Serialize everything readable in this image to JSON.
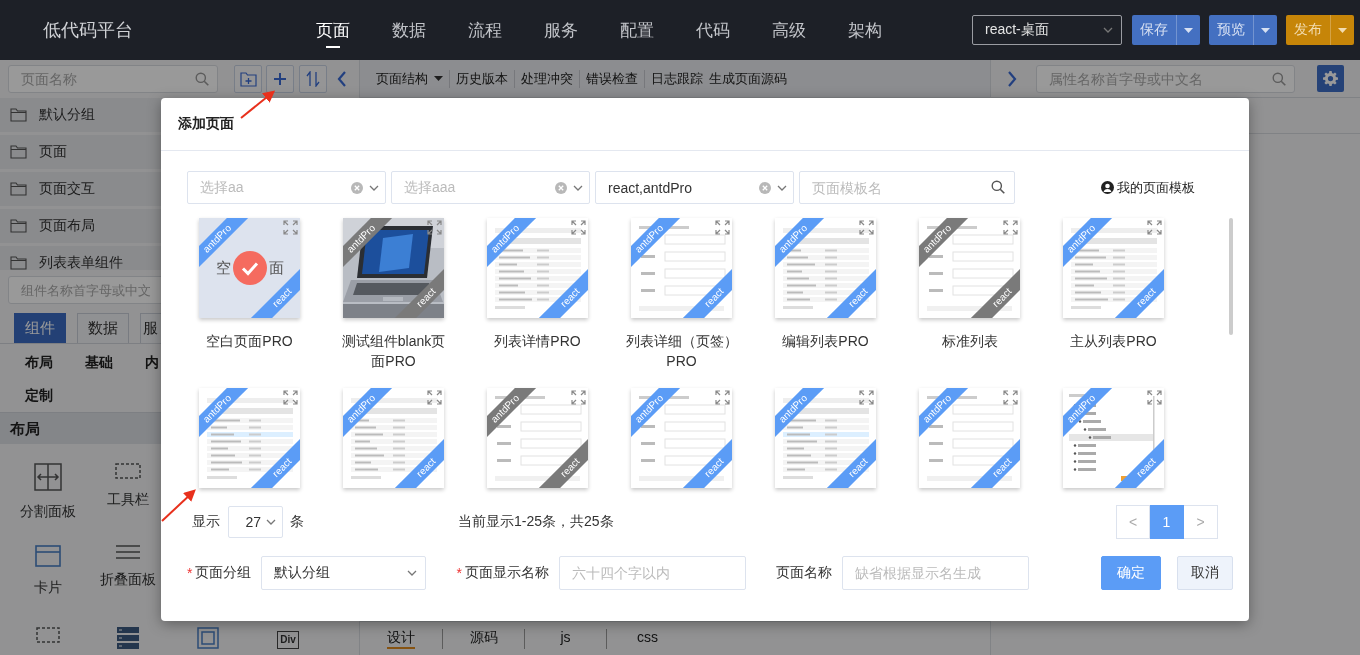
{
  "header": {
    "logo": "低代码平台",
    "nav": [
      {
        "label": "页面",
        "selected": true
      },
      {
        "label": "数据",
        "selected": false
      },
      {
        "label": "流程",
        "selected": false
      },
      {
        "label": "服务",
        "selected": false
      },
      {
        "label": "配置",
        "selected": false
      },
      {
        "label": "代码",
        "selected": false
      },
      {
        "label": "高级",
        "selected": false
      },
      {
        "label": "架构",
        "selected": false
      }
    ],
    "app_select": "react-桌面",
    "actions": [
      {
        "label": "保存",
        "kind": "primary"
      },
      {
        "label": "预览",
        "kind": "primary"
      },
      {
        "label": "发布",
        "kind": "warning"
      }
    ]
  },
  "left_panel": {
    "search_placeholder": "页面名称",
    "groups": [
      "默认分组",
      "页面",
      "页面交互",
      "页面布局",
      "列表表单组件"
    ],
    "component_search_placeholder": "组件名称首字母或中文",
    "tabs": [
      {
        "label": "组件",
        "selected": true
      },
      {
        "label": "数据",
        "selected": false
      },
      {
        "label": "服",
        "selected": false
      }
    ],
    "categories": [
      "布局",
      "基础",
      "内",
      "定制"
    ],
    "section": "布局",
    "component_rows": [
      [
        {
          "kind": "split",
          "label": "分割面板"
        },
        {
          "kind": "toolbar",
          "label": "工具栏"
        }
      ],
      [
        {
          "kind": "card",
          "label": "卡片"
        },
        {
          "kind": "collapse",
          "label": "折叠面板"
        }
      ],
      [
        {
          "kind": "dashed"
        },
        {
          "kind": "list"
        },
        {
          "kind": "frame"
        },
        {
          "kind": "tag",
          "tag": "Div"
        }
      ]
    ]
  },
  "center": {
    "toolbar": [
      {
        "label": "页面结构",
        "kind": "dropdown",
        "separated": false
      },
      {
        "label": "历史版本",
        "kind": "link",
        "separated": true
      },
      {
        "label": "处理冲突",
        "kind": "link",
        "separated": true
      },
      {
        "label": "错误检查",
        "kind": "link",
        "separated": true
      },
      {
        "label": "日志跟踪",
        "kind": "link",
        "separated": true
      },
      {
        "label": "生成页面源码",
        "kind": "link",
        "separated": false
      }
    ],
    "bottom_tabs": [
      {
        "label": "设计",
        "selected": true
      },
      {
        "label": "源码",
        "selected": false
      },
      {
        "label": "js",
        "selected": false
      },
      {
        "label": "css",
        "selected": false
      }
    ]
  },
  "right_panel": {
    "search_placeholder": "属性名称首字母或中文名"
  },
  "modal": {
    "title": "添加页面",
    "filters": [
      {
        "kind": "select",
        "placeholder": "选择aa"
      },
      {
        "kind": "select",
        "placeholder": "选择aaa"
      },
      {
        "kind": "select",
        "value": "react,antdPro"
      },
      {
        "kind": "search",
        "placeholder": "页面模板名"
      }
    ],
    "my_templates": "我的页面模板",
    "templates": [
      {
        "name": "空白页面PRO",
        "selected": true,
        "kind": "blank",
        "blank_text": [
          "空",
          "面"
        ],
        "tags": [
          {
            "text": "antdPro",
            "color": "#5b9cf6"
          },
          {
            "text": "react",
            "color": "#5b9cf6"
          }
        ]
      },
      {
        "name": "测试组件blank页面PRO",
        "selected": false,
        "kind": "picture",
        "tags": [
          {
            "text": "antdPro",
            "color": "#7a7a7a"
          },
          {
            "text": "react",
            "color": "#7a7a7a"
          }
        ]
      },
      {
        "name": "列表详情PRO",
        "selected": false,
        "kind": "table",
        "tags": [
          {
            "text": "antdPro",
            "color": "#5b9cf6"
          },
          {
            "text": "react",
            "color": "#5b9cf6"
          }
        ]
      },
      {
        "name": "列表详细（页签）PRO",
        "selected": false,
        "kind": "form",
        "tags": [
          {
            "text": "antdPro",
            "color": "#5b9cf6"
          },
          {
            "text": "react",
            "color": "#5b9cf6"
          }
        ]
      },
      {
        "name": "编辑列表PRO",
        "selected": false,
        "kind": "table",
        "tags": [
          {
            "text": "antdPro",
            "color": "#5b9cf6"
          },
          {
            "text": "react",
            "color": "#5b9cf6"
          }
        ]
      },
      {
        "name": "标准列表",
        "selected": false,
        "kind": "form",
        "tags": [
          {
            "text": "antdPro",
            "color": "#7a7a7a"
          },
          {
            "text": "react",
            "color": "#7a7a7a"
          }
        ]
      },
      {
        "name": "主从列表PRO",
        "selected": false,
        "kind": "table",
        "tags": [
          {
            "text": "antdPro",
            "color": "#5b9cf6"
          },
          {
            "text": "react",
            "color": "#5b9cf6"
          }
        ]
      },
      {
        "selected": false,
        "kind": "table",
        "tags": [
          {
            "text": "antdPro",
            "color": "#5b9cf6"
          },
          {
            "text": "react",
            "color": "#5b9cf6"
          }
        ]
      },
      {
        "selected": false,
        "kind": "table",
        "tags": [
          {
            "text": "antdPro",
            "color": "#5b9cf6"
          },
          {
            "text": "react",
            "color": "#5b9cf6"
          }
        ]
      },
      {
        "selected": false,
        "kind": "form",
        "tags": [
          {
            "text": "antdPro",
            "color": "#7a7a7a"
          },
          {
            "text": "react",
            "color": "#7a7a7a"
          }
        ]
      },
      {
        "selected": false,
        "kind": "form",
        "tags": [
          {
            "text": "antdPro",
            "color": "#5b9cf6"
          },
          {
            "text": "react",
            "color": "#5b9cf6"
          }
        ]
      },
      {
        "selected": false,
        "kind": "table",
        "tags": [
          {
            "text": "antdPro",
            "color": "#5b9cf6"
          },
          {
            "text": "react",
            "color": "#5b9cf6"
          }
        ]
      },
      {
        "selected": false,
        "kind": "form",
        "tags": [
          {
            "text": "antdPro",
            "color": "#5b9cf6"
          },
          {
            "text": "react",
            "color": "#5b9cf6"
          }
        ]
      },
      {
        "selected": false,
        "kind": "tree",
        "tags": [
          {
            "text": "antdPro",
            "color": "#5b9cf6"
          },
          {
            "text": "react",
            "color": "#5b9cf6"
          }
        ]
      }
    ],
    "page_size_label": "显示",
    "page_size": "27",
    "page_size_unit": "条",
    "summary": "当前显示1-25条，共25条",
    "prev": "<",
    "pages": [
      {
        "label": "1",
        "selected": true
      }
    ],
    "next": ">",
    "form": [
      {
        "mark": "*",
        "label": "页面分组",
        "kind": "select",
        "value": "默认分组"
      },
      {
        "mark": "*",
        "label": "页面显示名称",
        "kind": "input",
        "placeholder": "六十四个字以内"
      },
      {
        "label": "页面名称",
        "kind": "input",
        "placeholder": "缺省根据显示名生成"
      }
    ],
    "buttons": [
      {
        "label": "确定",
        "kind": "primary"
      },
      {
        "label": "取消",
        "kind": "default"
      }
    ]
  }
}
